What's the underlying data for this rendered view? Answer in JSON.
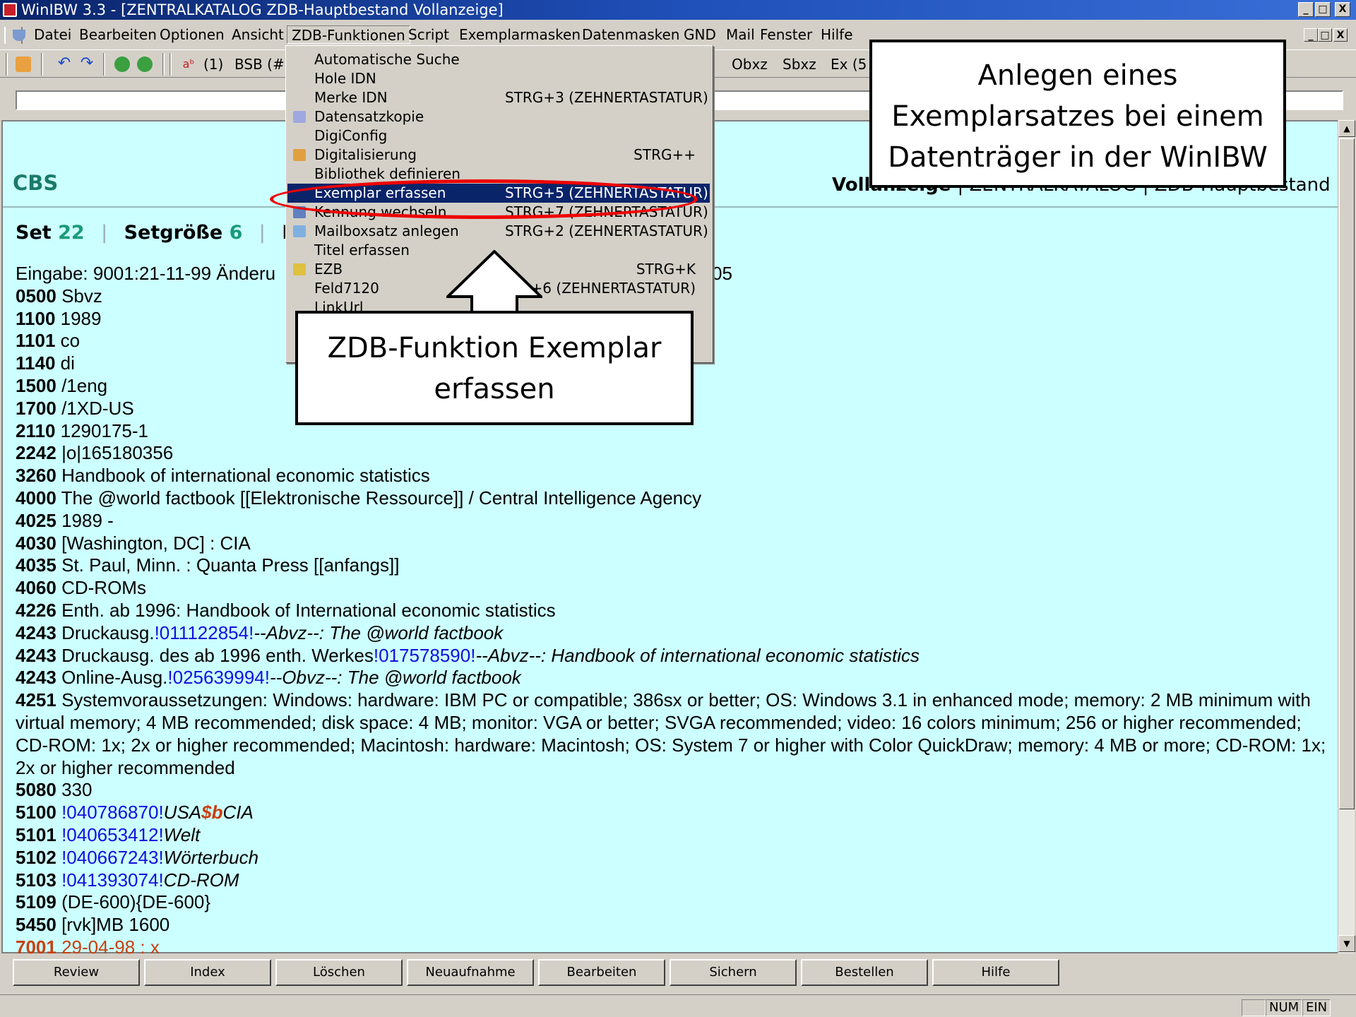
{
  "window": {
    "title": "WinIBW 3.3 - [ZENTRALKATALOG ZDB-Hauptbestand Vollanzeige]",
    "controls": [
      "_",
      "□",
      "X"
    ]
  },
  "menubar": {
    "items": [
      "Datei",
      "Bearbeiten",
      "Optionen",
      "Ansicht",
      "ZDB-Funktionen",
      "Script",
      "Exemplarmasken",
      "Datenmasken",
      "GND",
      "Mail",
      "Fenster",
      "Hilfe"
    ],
    "active": "ZDB-Funktionen"
  },
  "toolbar": {
    "paren1": "(1)",
    "bsb": "BSB (#)",
    "obxz": "Obxz",
    "sbxz": "Sbxz",
    "ex": "Ex (5"
  },
  "dropdown": {
    "items": [
      {
        "label": "Automatische Suche",
        "shortcut": "",
        "icon": ""
      },
      {
        "label": "Hole IDN",
        "shortcut": "",
        "icon": ""
      },
      {
        "label": "Merke IDN",
        "shortcut": "STRG+3 (ZEHNERTASTATUR)",
        "icon": ""
      },
      {
        "label": "Datensatzkopie",
        "shortcut": "",
        "icon": "copy-icon"
      },
      {
        "label": "DigiConfig",
        "shortcut": "",
        "icon": ""
      },
      {
        "label": "Digitalisierung",
        "shortcut": "STRG++",
        "icon": "house-icon"
      },
      {
        "label": "Bibliothek definieren",
        "shortcut": "",
        "icon": ""
      },
      {
        "label": "Exemplar erfassen",
        "shortcut": "STRG+5 (ZEHNERTASTATUR)",
        "icon": ""
      },
      {
        "label": "Kennung wechseln",
        "shortcut": "STRG+7 (ZEHNERTASTATUR)",
        "icon": "users-icon"
      },
      {
        "label": "Mailboxsatz anlegen",
        "shortcut": "STRG+2 (ZEHNERTASTATUR)",
        "icon": "mail-icon"
      },
      {
        "label": "Titel erfassen",
        "shortcut": "",
        "icon": ""
      },
      {
        "label": "EZB",
        "shortcut": "STRG+K",
        "icon": "folder-icon"
      },
      {
        "label": "Feld7120",
        "shortcut": "+6 (ZEHNERTASTATUR)",
        "icon": ""
      },
      {
        "label": "LinkUrl",
        "shortcut": "",
        "icon": ""
      }
    ],
    "highlighted": "Exemplar erfassen"
  },
  "header": {
    "cbs": "CBS",
    "view_title": "Vollanzeige",
    "view_rest": "| ZENTRALKATALOG | ZDB-Hauptbestand"
  },
  "setline": {
    "set_label": "Set",
    "set_value": "22",
    "size_label": "Setgröße",
    "size_value": "6",
    "d_label": "D"
  },
  "record": {
    "eingabe": "Eingabe: 9001:21-11-99 Änderu",
    "eingabe_tail": "05",
    "fields": [
      {
        "tag": "0500",
        "text": "Sbvz"
      },
      {
        "tag": "1100",
        "text": "1989"
      },
      {
        "tag": "1101",
        "text": "co"
      },
      {
        "tag": "1140",
        "text": "di"
      },
      {
        "tag": "1500",
        "text": "/1eng"
      },
      {
        "tag": "1700",
        "text": "/1XD-US"
      },
      {
        "tag": "2110",
        "text": "1290175-1"
      },
      {
        "tag": "2242",
        "text": "|o|165180356"
      },
      {
        "tag": "3260",
        "text": "Handbook of international economic statistics"
      },
      {
        "tag": "4000",
        "text": "The @world factbook [[Elektronische Ressource]] / Central Intelligence Agency"
      },
      {
        "tag": "4025",
        "text": "1989 -"
      },
      {
        "tag": "4030",
        "text": "[Washington, DC] : CIA"
      },
      {
        "tag": "4035",
        "text": "St. Paul, Minn. : Quanta Press [[anfangs]]"
      },
      {
        "tag": "4060",
        "text": "CD-ROMs"
      },
      {
        "tag": "4226",
        "text": "Enth. ab 1996: Handbook of International economic statistics"
      }
    ],
    "links": [
      {
        "tag": "4243",
        "pre": "Druckausg.",
        "link": "!011122854!",
        "post": "--Abvz--: The @world factbook"
      },
      {
        "tag": "4243",
        "pre": "Druckausg. des ab 1996 enth. Werkes",
        "link": "!017578590!",
        "post": "--Abvz--: Handbook of international economic statistics"
      },
      {
        "tag": "4243",
        "pre": "Online-Ausg.",
        "link": "!025639994!",
        "post": "--Obvz--: The @world factbook"
      }
    ],
    "f4251_tag": "4251",
    "f4251_text": "Systemvoraussetzungen: Windows: hardware: IBM PC or compatible; 386sx or better; OS: Windows 3.1 in enhanced mode; memory: 2 MB minimum with virtual memory; 4 MB recommended; disk space: 4 MB; monitor: VGA or better; SVGA recommended; video: 16 colors minimum; 256 or higher recommended; CD-ROM: 1x; 2x or higher recommended; Macintosh: hardware: Macintosh; OS: System 7 or higher with Color QuickDraw; memory: 4 MB or more; CD-ROM: 1x; 2x or higher recommended",
    "f5080_tag": "5080",
    "f5080_text": "330",
    "f5100_tag": "5100",
    "f5100_link": "!040786870!",
    "f5100_a": "USA",
    "f5100_b": "$b",
    "f5100_c": "CIA",
    "subjects": [
      {
        "tag": "5101",
        "link": "!040653412!",
        "text": "Welt"
      },
      {
        "tag": "5102",
        "link": "!040667243!",
        "text": "Wörterbuch"
      },
      {
        "tag": "5103",
        "link": "!041393074!",
        "text": "CD-ROM"
      }
    ],
    "f5109_tag": "5109",
    "f5109_text": "(DE-600){DE-600}",
    "f5450_tag": "5450",
    "f5450_text": "[rvk]MB 1600",
    "f7001_tag": "7001",
    "f7001_text": "29-04-98 : x"
  },
  "buttons": [
    "Review",
    "Index",
    "Löschen",
    "Neuaufnahme",
    "Bearbeiten",
    "Sichern",
    "Bestellen",
    "Hilfe"
  ],
  "statusbar": {
    "num": "NUM",
    "ein": "EIN"
  },
  "callouts": {
    "top_right": [
      "Anlegen eines",
      "Exemplarsatzes bei einem",
      "Datenträger in der WinIBW"
    ],
    "center": [
      "ZDB-Funktion Exemplar",
      "erfassen"
    ]
  },
  "colors": {
    "title_bar": "#0a246a",
    "content_bg": "#ccffff",
    "link": "#1010e0",
    "highlight": "#0a246a",
    "ellipse": "#e00000",
    "cbs": "#1a7a6a"
  }
}
